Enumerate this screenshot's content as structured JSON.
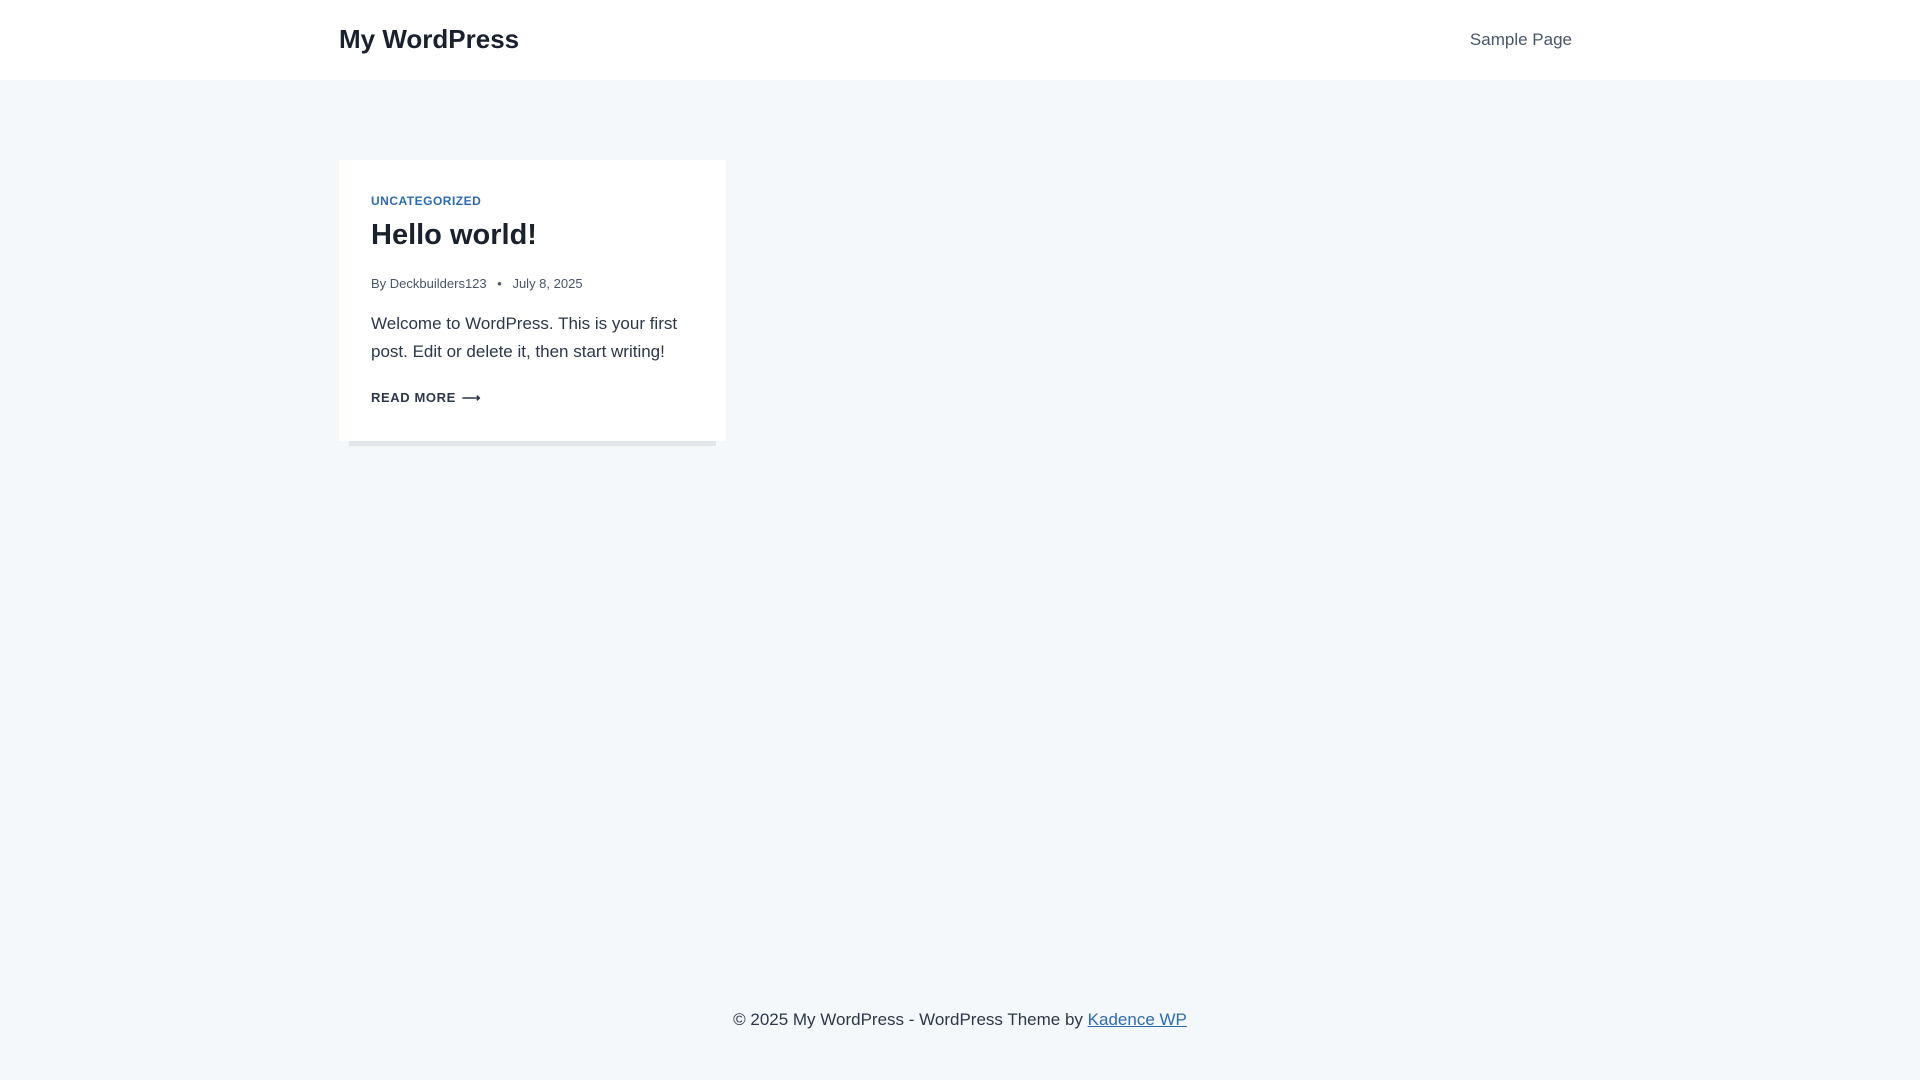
{
  "header": {
    "site_title": "My WordPress",
    "nav": [
      {
        "label": "Sample Page"
      }
    ]
  },
  "posts": [
    {
      "category": "UNCATEGORIZED",
      "title": "Hello world!",
      "meta": {
        "by_label": "By",
        "author": "Deckbuilders123",
        "separator": "•",
        "date": "July 8, 2025"
      },
      "excerpt": "Welcome to WordPress. This is your first post. Edit or delete it, then start writing!",
      "read_more": "READ MORE",
      "read_more_arrow": "⟶"
    }
  ],
  "footer": {
    "text": "© 2025 My WordPress - WordPress Theme by",
    "link_label": "Kadence WP"
  },
  "colors": {
    "background": "#f5f8fb",
    "accent": "#2b6cb0",
    "text": "#1a202c"
  }
}
